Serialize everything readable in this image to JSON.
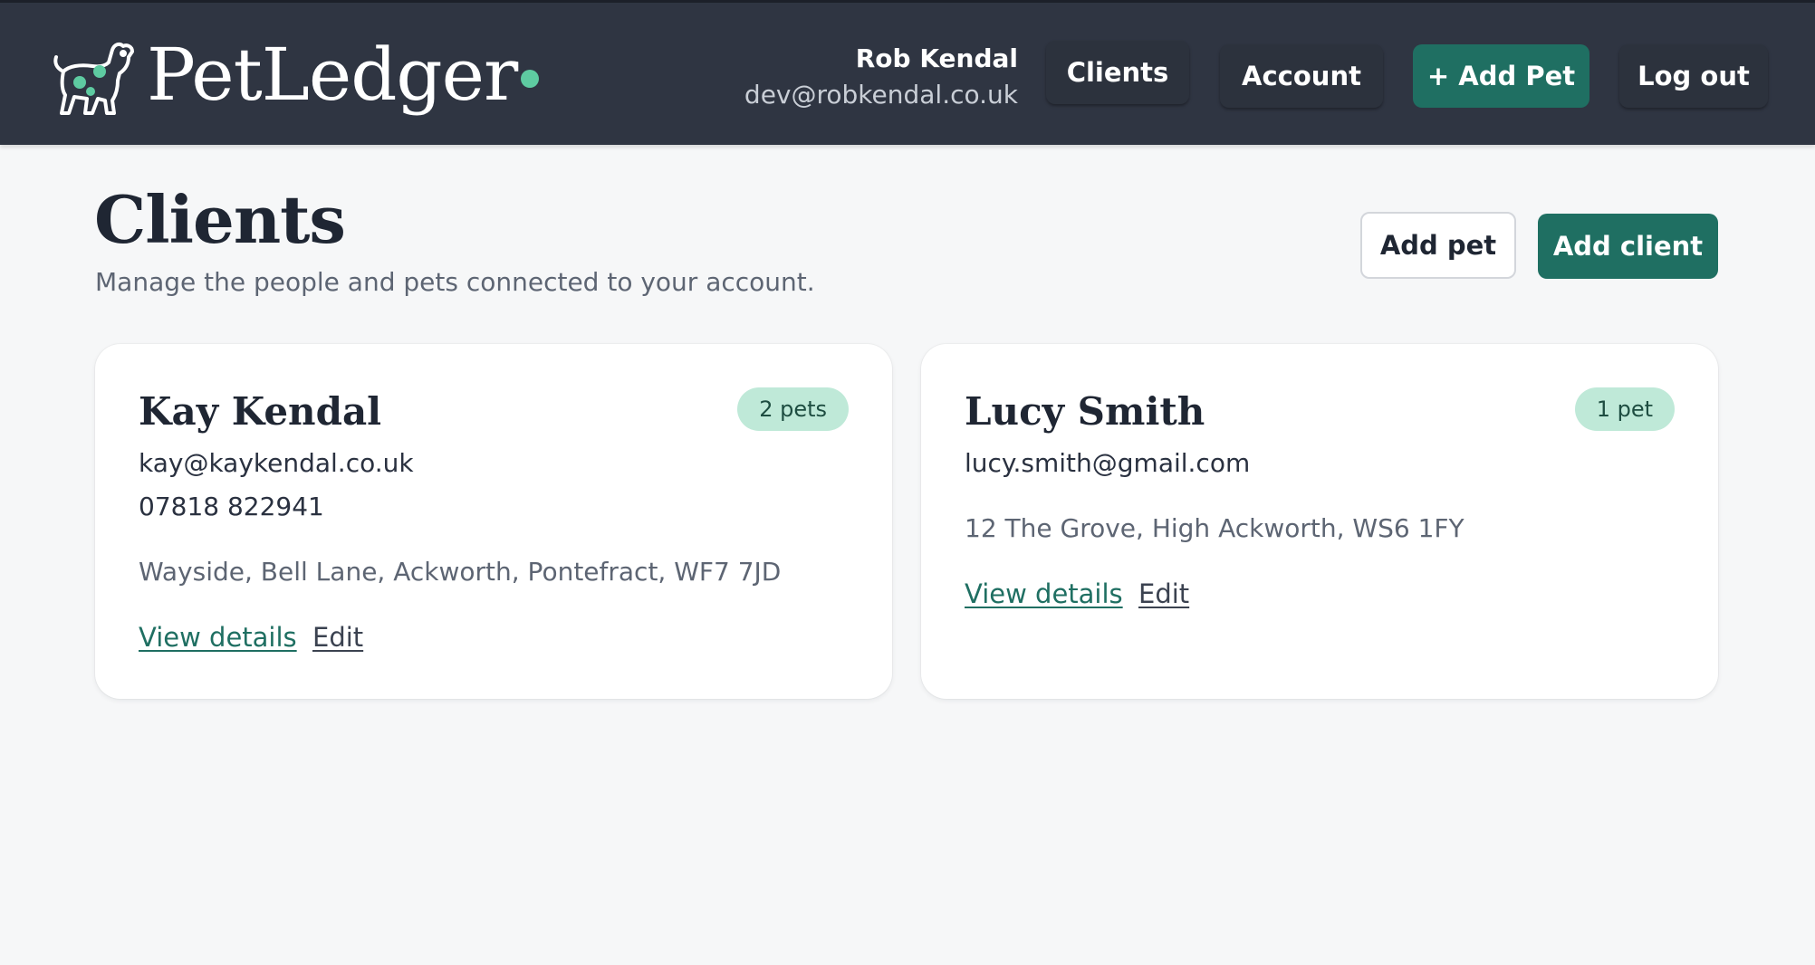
{
  "header": {
    "brand": "PetLedger",
    "logo_icon": "dog-icon",
    "user": {
      "name": "Rob Kendal",
      "email": "dev@robkendal.co.uk"
    },
    "nav": {
      "clients": "Clients",
      "account": "Account",
      "add_pet": "+ Add Pet",
      "logout": "Log out"
    }
  },
  "page": {
    "title": "Clients",
    "subtitle": "Manage the people and pets connected to your account.",
    "actions": {
      "add_pet": "Add pet",
      "add_client": "Add client"
    }
  },
  "clients": [
    {
      "name": "Kay Kendal",
      "pets_badge": "2 pets",
      "email": "kay@kaykendal.co.uk",
      "phone": "07818 822941",
      "address": "Wayside, Bell Lane, Ackworth, Pontefract, WF7 7JD",
      "view_label": "View details",
      "edit_label": "Edit"
    },
    {
      "name": "Lucy Smith",
      "pets_badge": "1 pet",
      "email": "lucy.smith@gmail.com",
      "address": "12 The Grove, High Ackworth, WS6 1FY",
      "view_label": "View details",
      "edit_label": "Edit"
    }
  ],
  "colors": {
    "header_bg": "#2f3542",
    "accent": "#1f6f62",
    "badge_bg": "#bfe9d8",
    "brand_dot": "#5ecba1",
    "page_bg": "#f6f7f8"
  }
}
